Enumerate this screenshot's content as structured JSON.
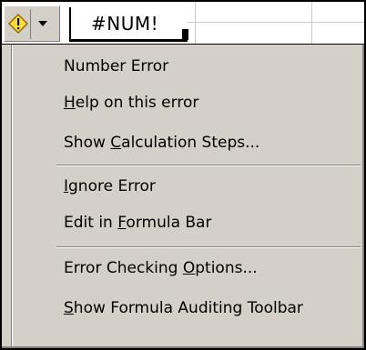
{
  "cell": {
    "value": "#NUM!"
  },
  "menu": {
    "header": "Number Error",
    "items": [
      {
        "id": "help",
        "before": "",
        "key": "H",
        "after": "elp on this error"
      },
      {
        "id": "calc",
        "before": "Show ",
        "key": "C",
        "after": "alculation Steps..."
      },
      {
        "id": "ignore",
        "before": "",
        "key": "I",
        "after": "gnore Error"
      },
      {
        "id": "edit",
        "before": "Edit in ",
        "key": "F",
        "after": "ormula Bar"
      },
      {
        "id": "options",
        "before": "Error Checking ",
        "key": "O",
        "after": "ptions..."
      },
      {
        "id": "auditing",
        "before": "",
        "key": "S",
        "after": "how Formula Auditing Toolbar"
      }
    ]
  },
  "colors": {
    "menu_face": "#d4d0c8",
    "warning_fill": "#ffdc3c",
    "warning_border": "#8a6a00"
  },
  "icons": {
    "smart_tag": "warning-diamond-icon",
    "dropdown": "chevron-down-icon"
  }
}
